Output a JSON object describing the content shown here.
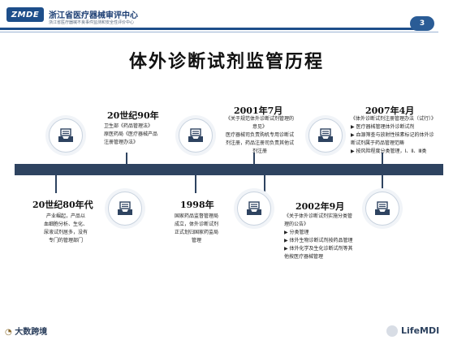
{
  "header": {
    "logo_text": "ZMDE",
    "org_name": "浙江省医疗器械审评中心",
    "org_sub": "浙江省医疗器械不良事件监测和安全性评价中心",
    "page_number": "3"
  },
  "title": "体外诊断试剂监管历程",
  "milestones": [
    {
      "year": "20世纪80年代",
      "lines": [
        "产业崛起，产品以",
        "血细胞分析、生化、",
        "尿液试剂居多，没有",
        "专门的管理部门"
      ]
    },
    {
      "year": "20世纪90年",
      "lines": [
        "卫生部《药品管理法》",
        "原医药局《医疗器械产品",
        "注册管理办法》"
      ]
    },
    {
      "year": "1998年",
      "lines": [
        "国家药品监督管理局",
        "成立，体外诊断试剂",
        "正式划归国家药监局",
        "管理"
      ]
    },
    {
      "year": "2001年7月",
      "lines": [
        "《关于规范体外诊断试剂管理的",
        "意见》",
        "医疗器械司负责购机专用诊断试",
        "剂注册，药品注册司负责其他试",
        "剂注册"
      ]
    },
    {
      "year": "2002年9月",
      "lines": [
        "《关于体外诊断试剂实施分类管",
        "理的公告》",
        "▶ 分类管理",
        "▶ 体外生物诊断试剂按药品管理",
        "▶ 体外化学及生化诊断试剂等其",
        "  他按医疗器械管理"
      ]
    },
    {
      "year": "2007年4月",
      "lines": [
        "《体外诊断试剂注册管理办法（试行）》",
        "▶ 医疗器械管理体外诊断试剂",
        "▶ 血源筛查与放射性核素标记的体外诊",
        "  断试剂属于药品管理范畴",
        "▶ 按风险程度分类管理，Ⅰ、Ⅱ、Ⅲ类"
      ]
    }
  ],
  "footer": {
    "left_logo": "大数跨境",
    "brand": "LifeMDI"
  },
  "icons": {
    "node_icon": "inbox-tray-icon",
    "colors": {
      "primary": "#2e4360",
      "accent": "#1d4e8a"
    }
  }
}
